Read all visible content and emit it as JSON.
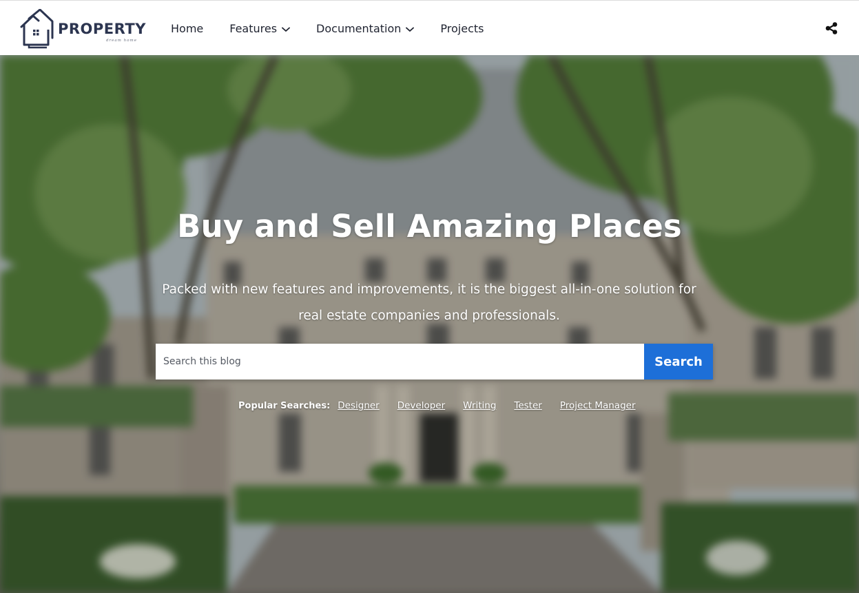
{
  "header": {
    "logo": {
      "word": "PROPERTY",
      "tagline": "dream home",
      "icon": "house-logo-icon"
    },
    "nav": [
      {
        "label": "Home",
        "has_dropdown": false
      },
      {
        "label": "Features",
        "has_dropdown": true
      },
      {
        "label": "Documentation",
        "has_dropdown": true
      },
      {
        "label": "Projects",
        "has_dropdown": false
      }
    ],
    "share_icon": "share-icon"
  },
  "hero": {
    "title": "Buy and Sell Amazing Places",
    "subtitle": "Packed with new features and improvements, it is the biggest all-in-one solution for real estate companies and professionals.",
    "search": {
      "placeholder": "Search this blog",
      "button_label": "Search"
    },
    "popular": {
      "label": "Popular Searches:",
      "links": [
        "Designer",
        "Developer",
        "Writing",
        "Tester",
        "Project Manager"
      ]
    }
  },
  "colors": {
    "brand_text": "#2c3550",
    "search_button": "#1d6fd8",
    "nav_text": "#1f2330"
  }
}
